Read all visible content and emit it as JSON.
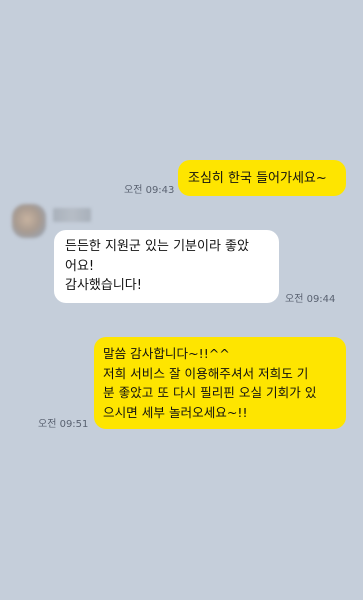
{
  "messages": [
    {
      "direction": "outgoing",
      "text": "조심히 한국 들어가세요~",
      "time": "오전 09:43"
    },
    {
      "direction": "incoming",
      "text": "든든한 지원군 있는 기분이라 좋았\n어요!\n감사했습니다!",
      "time": "오전 09:44"
    },
    {
      "direction": "outgoing",
      "text": "말씀 감사합니다~!!^^\n저희 서비스 잘 이용해주셔서 저희도 기\n분 좋았고 또 다시 필리핀 오실 기회가 있\n으시면 세부 놀러오세요~!!",
      "time": "오전 09:51"
    }
  ],
  "colors": {
    "background": "#c5ceda",
    "outgoing_bubble": "#fee500",
    "incoming_bubble": "#ffffff",
    "time_text": "#5a6271"
  },
  "icons": {
    "avatar": "blurred-profile-photo"
  }
}
